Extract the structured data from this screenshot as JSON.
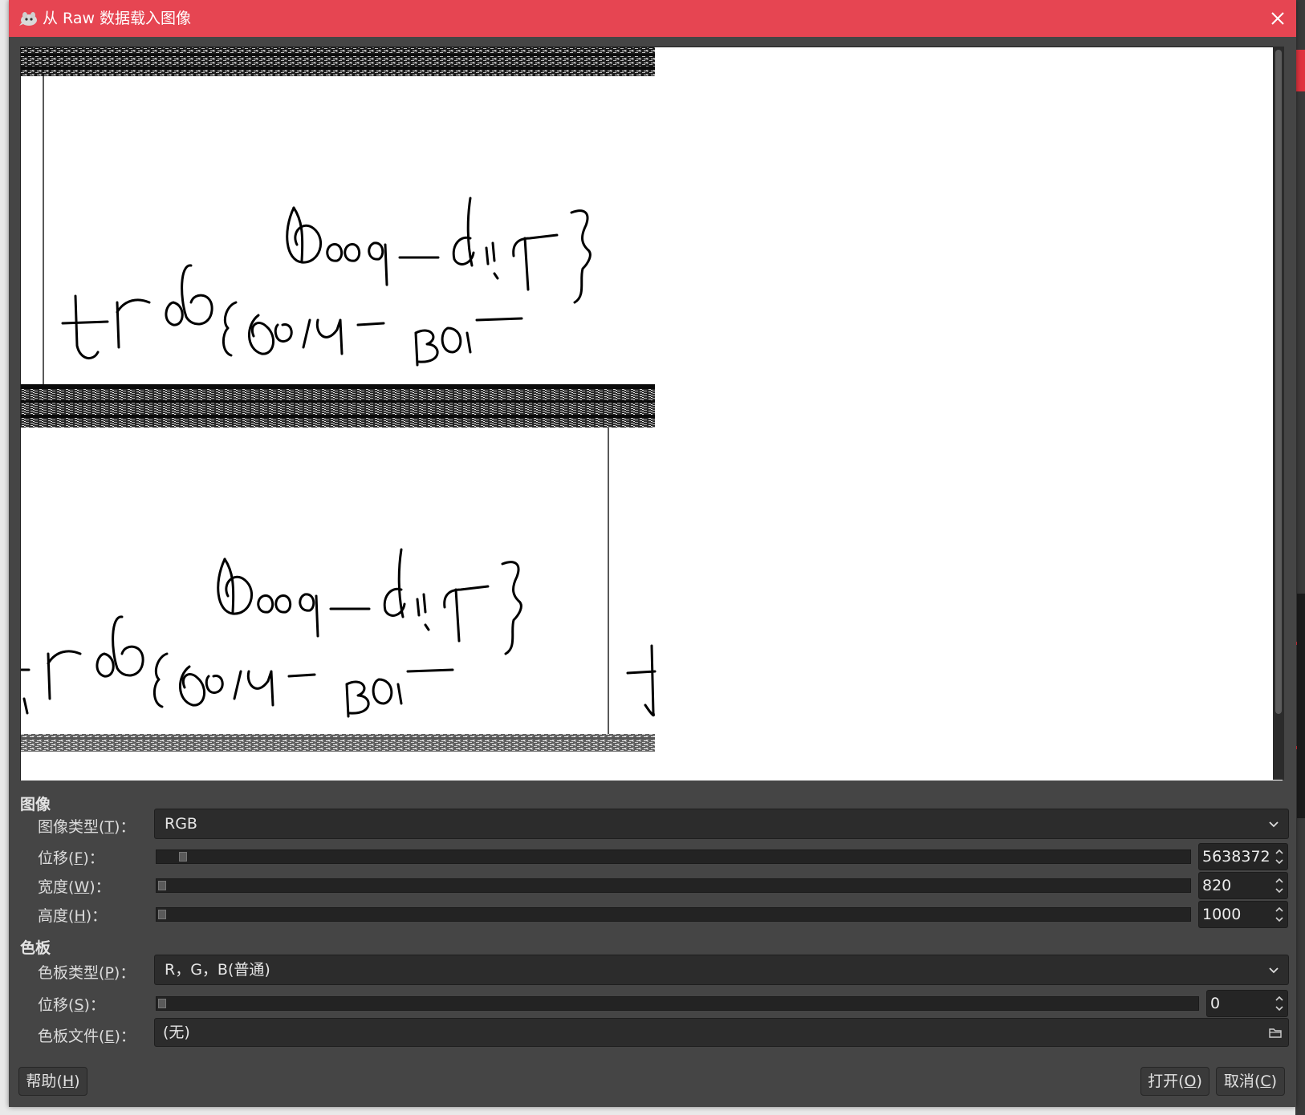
{
  "window": {
    "title": "从 Raw 数据载入图像",
    "title_color": "#e64552",
    "title_icon": "gimp-wilber-icon",
    "close_icon": "close-icon"
  },
  "preview": {
    "scrollbar": "vertical-scrollbar"
  },
  "image_section": {
    "heading": "图像",
    "image_type": {
      "label": "图像类型",
      "mnemonic": "T",
      "suffix": "：",
      "value": "RGB"
    },
    "offset": {
      "label": "位移",
      "mnemonic": "F",
      "suffix": "：",
      "value": "5638372"
    },
    "width": {
      "label": "宽度",
      "mnemonic": "W",
      "suffix": "：",
      "value": "820"
    },
    "height": {
      "label": "高度",
      "mnemonic": "H",
      "suffix": "：",
      "value": "1000"
    }
  },
  "palette_section": {
    "heading": "色板",
    "palette_type": {
      "label": "色板类型",
      "mnemonic": "P",
      "suffix": "：",
      "value": "R，G，B(普通)"
    },
    "offset": {
      "label": "位移",
      "mnemonic": "S",
      "suffix": "：",
      "value": "0"
    },
    "palette_file": {
      "label": "色板文件",
      "mnemonic": "E",
      "suffix": "：",
      "value": "(无)"
    }
  },
  "buttons": {
    "help": {
      "label": "帮助",
      "mnemonic": "H"
    },
    "open": {
      "label": "打开",
      "mnemonic": "O"
    },
    "cancel": {
      "label": "取消",
      "mnemonic": "C"
    }
  }
}
